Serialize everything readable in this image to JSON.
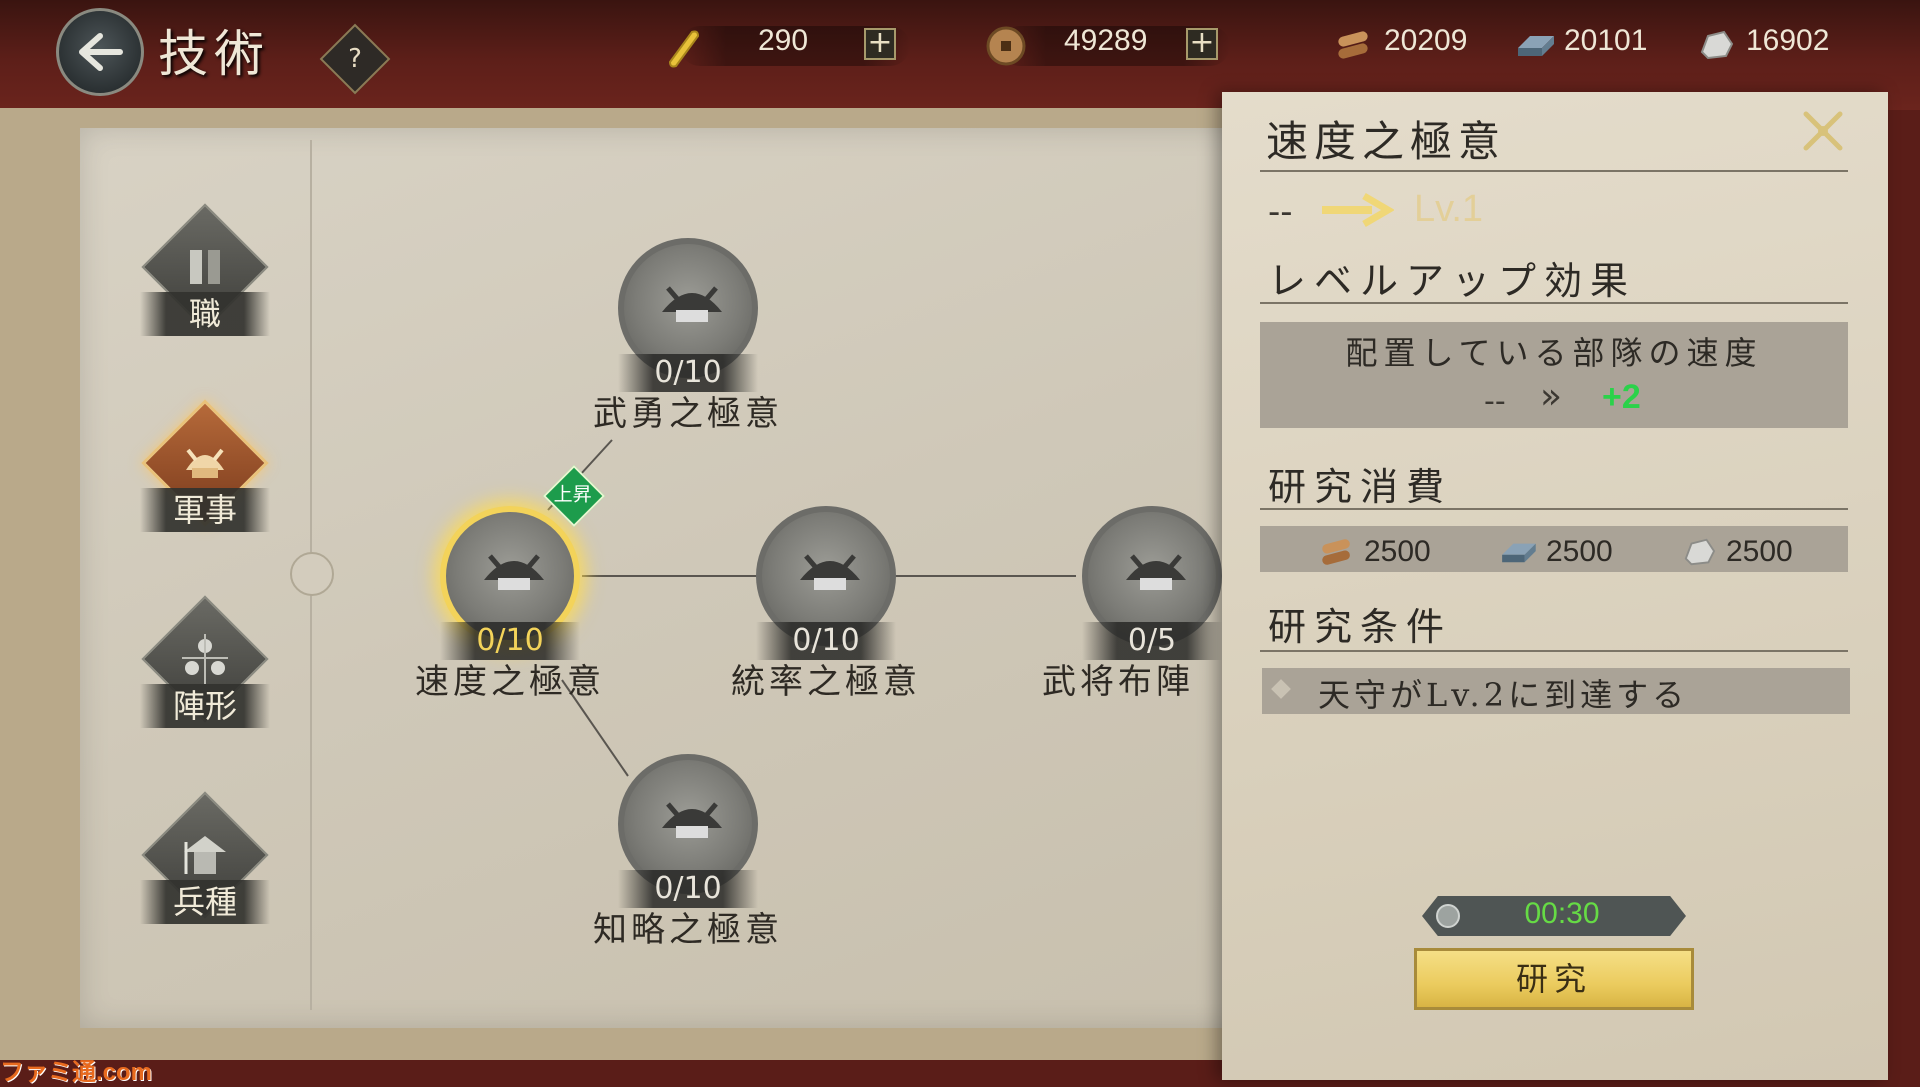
{
  "header": {
    "title": "技術",
    "help_label": "?",
    "gold": "290",
    "coin": "49289",
    "wood": "20209",
    "iron": "20101",
    "stone": "16902",
    "icons": [
      "back-arrow-icon",
      "gold-bar-icon",
      "coin-icon",
      "plus-icon",
      "wood-icon",
      "iron-ingot-icon",
      "stone-icon"
    ]
  },
  "sidebar": {
    "items": [
      {
        "label": "職",
        "icon": "job-icon",
        "active": false
      },
      {
        "label": "軍事",
        "icon": "samurai-helmet-icon",
        "active": true
      },
      {
        "label": "陣形",
        "icon": "formation-icon",
        "active": false
      },
      {
        "label": "兵種",
        "icon": "soldier-icon",
        "active": false
      }
    ]
  },
  "tree": {
    "nodes": [
      {
        "name": "武勇之極意",
        "level": "0/10"
      },
      {
        "name": "速度之極意",
        "level": "0/10",
        "selected": true
      },
      {
        "name": "統率之極意",
        "level": "0/10"
      },
      {
        "name": "武将布陣",
        "level": "0/5"
      },
      {
        "name": "知略之極意",
        "level": "0/10"
      }
    ],
    "badge": "上昇"
  },
  "panel": {
    "title": "速度之極意",
    "level_from": "--",
    "level_to": "Lv.1",
    "effect_header": "レベルアップ効果",
    "effect_desc": "配置している部隊の速度",
    "effect_from": "--",
    "effect_arrow": "»",
    "effect_to": "+2",
    "cost_header": "研究消費",
    "costs": [
      {
        "icon": "wood-icon",
        "value": "2500"
      },
      {
        "icon": "iron-ingot-icon",
        "value": "2500"
      },
      {
        "icon": "stone-icon",
        "value": "2500"
      }
    ],
    "cond_header": "研究条件",
    "condition": "天守がLv.2に到達する",
    "timer": "00:30",
    "research_label": "研究"
  },
  "watermark": "ファミ通.com",
  "colors": {
    "accent_gold": "#f3d35a",
    "effect_green": "#2bd24a",
    "timer_green": "#66db45",
    "badge_green": "#1d9c4c"
  }
}
